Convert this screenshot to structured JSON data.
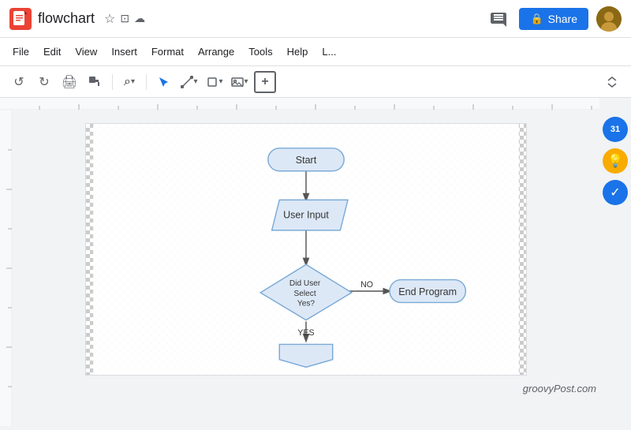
{
  "header": {
    "title": "flowchart",
    "share_label": "Share",
    "share_icon": "🔒"
  },
  "menubar": {
    "items": [
      "File",
      "Edit",
      "View",
      "Insert",
      "Format",
      "Arrange",
      "Tools",
      "Help",
      "L..."
    ]
  },
  "toolbar": {
    "zoom_label": "⌕",
    "buttons": [
      "undo",
      "redo",
      "print",
      "paint-format",
      "zoom",
      "select",
      "line",
      "shape-picker",
      "image",
      "plus"
    ]
  },
  "sidebar": {
    "icons": [
      {
        "name": "calendar",
        "label": "31"
      },
      {
        "name": "lightbulb",
        "label": "💡"
      },
      {
        "name": "check",
        "label": "✓"
      }
    ]
  },
  "flowchart": {
    "nodes": [
      {
        "id": "start",
        "label": "Start",
        "type": "rounded-rect"
      },
      {
        "id": "user-input",
        "label": "User Input",
        "type": "parallelogram"
      },
      {
        "id": "decision",
        "label": "Did User\nSelect\nYes?",
        "type": "diamond"
      },
      {
        "id": "end-program",
        "label": "End Program",
        "type": "rounded-rect"
      },
      {
        "id": "bottom",
        "label": "",
        "type": "pentagon"
      }
    ],
    "labels": {
      "no_label": "NO",
      "yes_label": "YES"
    }
  },
  "watermark": {
    "text": "groovyPost.com"
  }
}
